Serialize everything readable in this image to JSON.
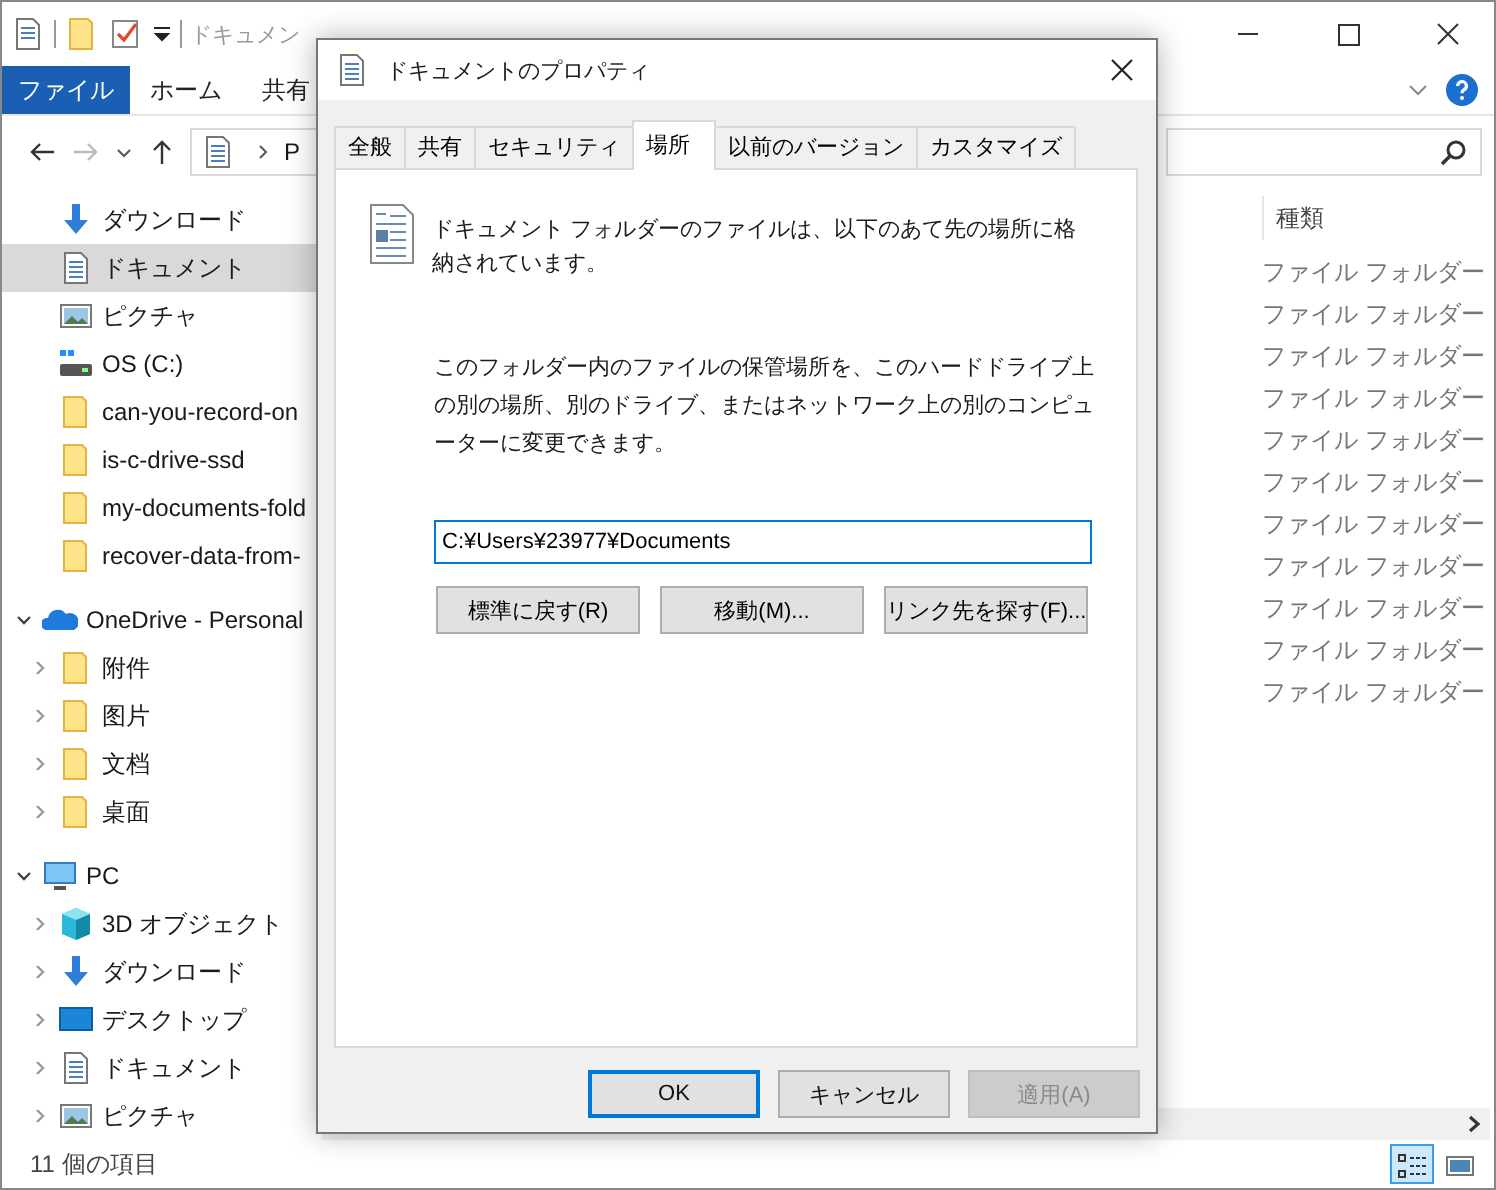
{
  "window": {
    "title": "ドキュメン"
  },
  "ribbon_tabs": [
    {
      "label": "ファイル",
      "selected": true
    },
    {
      "label": "ホーム",
      "selected": false
    },
    {
      "label": "共有",
      "selected": false
    }
  ],
  "address_bar": {
    "path": "P"
  },
  "quick_access": [
    {
      "label": "ダウンロード",
      "kind": "download",
      "selected": false
    },
    {
      "label": "ドキュメント",
      "kind": "document",
      "selected": true
    },
    {
      "label": "ピクチャ",
      "kind": "picture",
      "selected": false
    },
    {
      "label": "OS (C:)",
      "kind": "drive",
      "selected": false
    },
    {
      "label": "can-you-record-on",
      "kind": "folder",
      "selected": false
    },
    {
      "label": "is-c-drive-ssd",
      "kind": "folder",
      "selected": false
    },
    {
      "label": "my-documents-fold",
      "kind": "folder",
      "selected": false
    },
    {
      "label": "recover-data-from-",
      "kind": "folder",
      "selected": false
    }
  ],
  "nav_tree": [
    {
      "label": "OneDrive - Personal",
      "kind": "cloud",
      "selected": false,
      "expanded": true,
      "children": [
        {
          "label": "附件",
          "kind": "folder",
          "selected": false,
          "expanded": false
        },
        {
          "label": "图片",
          "kind": "folder",
          "selected": false,
          "expanded": false
        },
        {
          "label": "文档",
          "kind": "folder",
          "selected": false,
          "expanded": false
        },
        {
          "label": "桌面",
          "kind": "folder",
          "selected": false,
          "expanded": false
        }
      ]
    },
    {
      "label": "PC",
      "kind": "pc",
      "selected": false,
      "expanded": true,
      "children": [
        {
          "label": "3D オブジェクト",
          "kind": "cube",
          "selected": false,
          "expanded": false
        },
        {
          "label": "ダウンロード",
          "kind": "download",
          "selected": false,
          "expanded": false
        },
        {
          "label": "デスクトップ",
          "kind": "desktop",
          "selected": false,
          "expanded": false
        },
        {
          "label": "ドキュメント",
          "kind": "document",
          "selected": false,
          "expanded": false
        },
        {
          "label": "ピクチャ",
          "kind": "picture",
          "selected": false,
          "expanded": false
        }
      ]
    }
  ],
  "file_list": {
    "column": "種類",
    "types": [
      "ファイル フォルダー",
      "ファイル フォルダー",
      "ファイル フォルダー",
      "ファイル フォルダー",
      "ファイル フォルダー",
      "ファイル フォルダー",
      "ファイル フォルダー",
      "ファイル フォルダー",
      "ファイル フォルダー",
      "ファイル フォルダー",
      "ファイル フォルダー"
    ]
  },
  "status_bar": {
    "count": "11 個の項目",
    "views": [
      {
        "kind": "details",
        "selected": true
      },
      {
        "kind": "large",
        "selected": false
      }
    ]
  },
  "dialog": {
    "title": "ドキュメントのプロパティ",
    "tabs": [
      {
        "label": "全般",
        "selected": false
      },
      {
        "label": "共有",
        "selected": false
      },
      {
        "label": "セキュリティ",
        "selected": false
      },
      {
        "label": "場所",
        "selected": true
      },
      {
        "label": "以前のバージョン",
        "selected": false
      },
      {
        "label": "カスタマイズ",
        "selected": false
      }
    ],
    "description": "ドキュメント フォルダーのファイルは、以下のあて先の場所に格納されています。",
    "instruction": "このフォルダー内のファイルの保管場所を、このハードドライブ上の別の場所、別のドライブ、またはネットワーク上の別のコンピューターに変更できます。",
    "path": "C:¥Users¥23977¥Documents",
    "actions": [
      "標準に戻す(R)",
      "移動(M)...",
      "リンク先を探す(F)..."
    ],
    "buttons": [
      {
        "label": "OK",
        "default": true,
        "disabled": false
      },
      {
        "label": "キャンセル",
        "default": false,
        "disabled": false
      },
      {
        "label": "適用(A)",
        "default": false,
        "disabled": true
      }
    ]
  }
}
